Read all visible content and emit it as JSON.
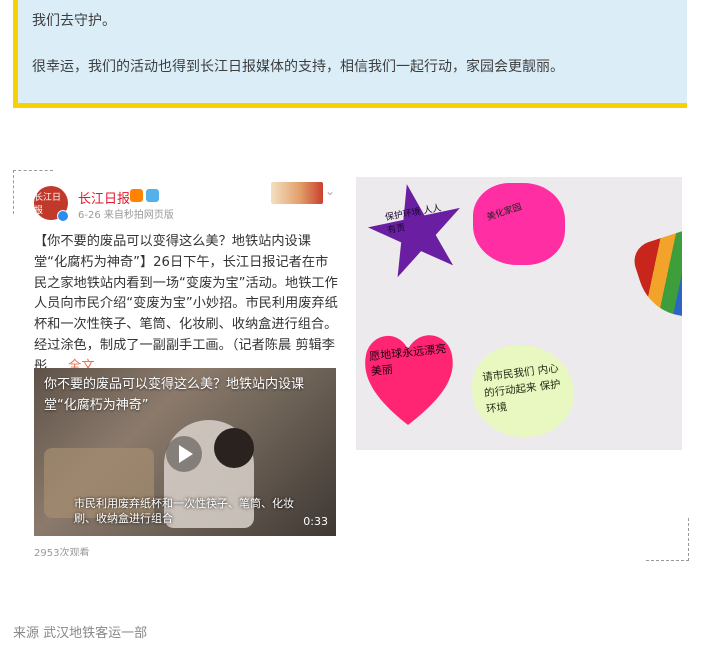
{
  "quote": {
    "line1": "我们去守护。",
    "line2": "很幸运，我们的活动也得到长江日报媒体的支持，相信我们一起行动，家园会更靓丽。"
  },
  "weibo_card": {
    "avatar_text": "长江日报",
    "account_name": "长江日报",
    "meta": "6-26  来自秒拍网页版",
    "post_text": "【你不要的废品可以变得这么美？地铁站内设课堂“化腐朽为神奇”】26日下午，长江日报记者在市民之家地铁站内看到一场“变废为宝”活动。地铁工作人员向市民介绍“变废为宝”小妙招。市民利用废弃纸杯和一次性筷子、笔筒、化妆刷、收纳盒进行组合。经过涂色，制成了一副副手工画。（记者陈晨 剪辑李彤 ...",
    "more_link": "全文",
    "video": {
      "title": "你不要的废品可以变得这么美？地铁站内设课堂“化腐朽为神奇”",
      "subtitle": "市民利用废弃纸杯和一次性筷子、笔筒、化妆刷、收纳盒进行组合",
      "duration": "0:33"
    },
    "views": "2953次观看"
  },
  "photo_notes": {
    "star": "保护环境 人人有责",
    "cloud": "美化家园",
    "heart": "愿地球永远漂亮美丽",
    "flower": "请市民我们 内心的行动起来 保护环境"
  },
  "source": "来源  武汉地铁客运一部",
  "colors": {
    "quote_bg": "#dbeef8",
    "quote_accent": "#f5d200",
    "weibo_name": "#e6162d",
    "more_link": "#eb7350"
  }
}
